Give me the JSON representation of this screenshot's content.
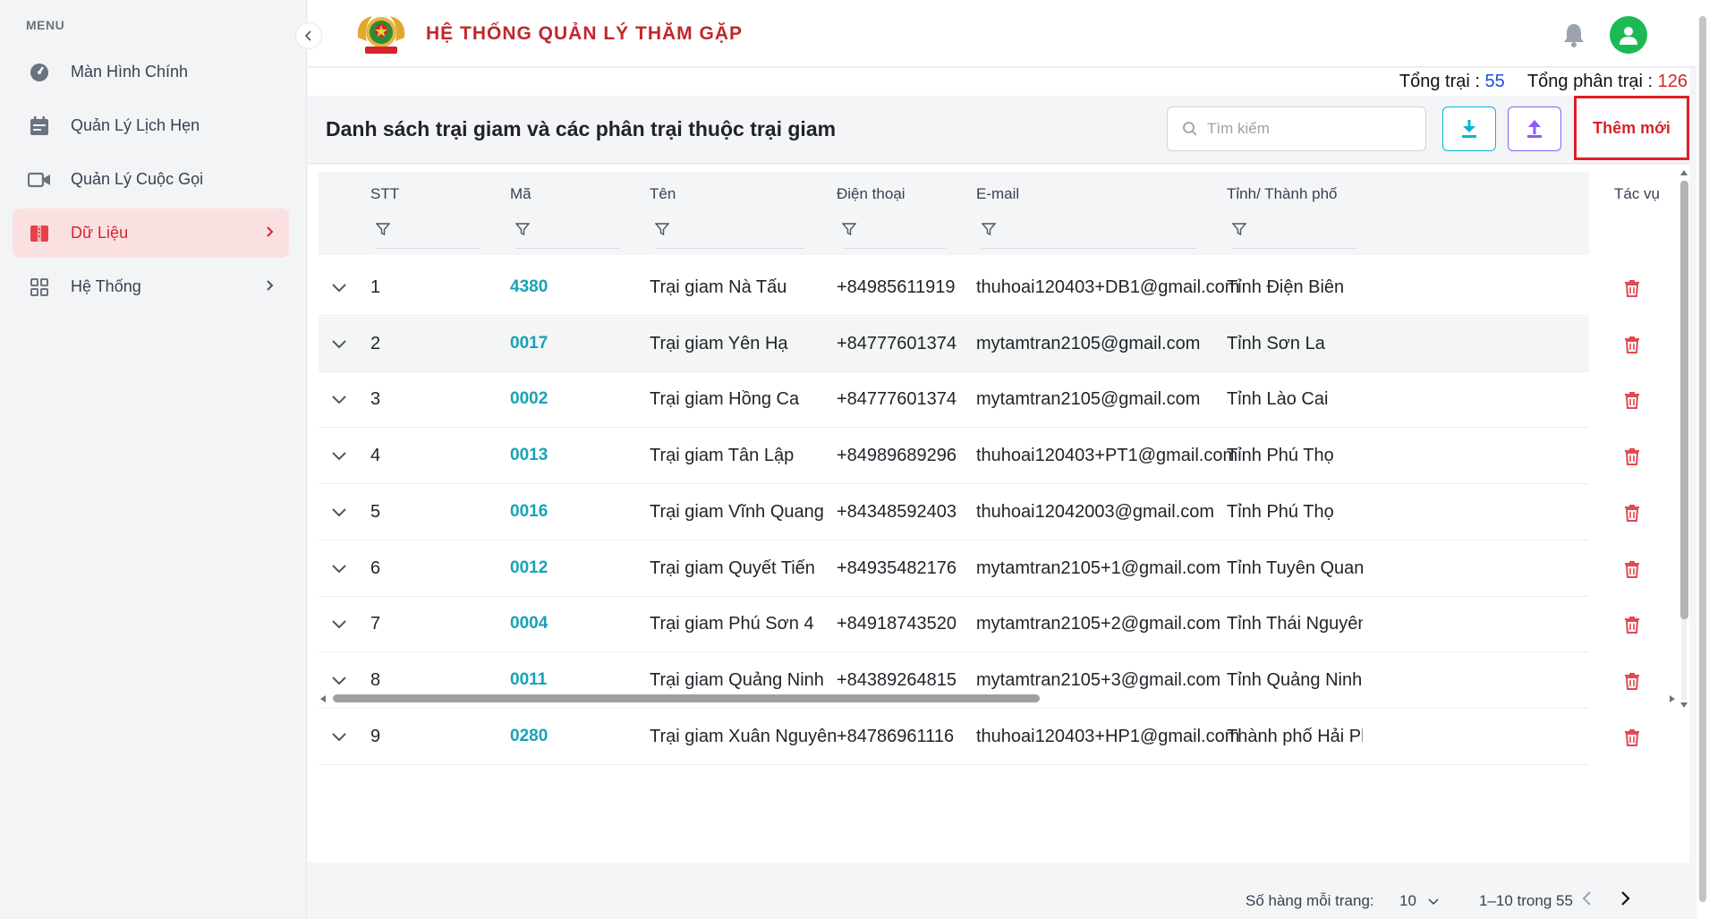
{
  "sidebar": {
    "menu_label": "MENU",
    "items": [
      {
        "label": "Màn Hình Chính",
        "icon": "dashboard-icon"
      },
      {
        "label": "Quản Lý Lịch Hẹn",
        "icon": "calendar-icon"
      },
      {
        "label": "Quản Lý Cuộc Gọi",
        "icon": "video-camera-icon"
      },
      {
        "label": "Dữ Liệu",
        "icon": "folder-icon",
        "active": true
      },
      {
        "label": "Hệ Thống",
        "icon": "grid-icon"
      }
    ]
  },
  "header": {
    "title": "HỆ THỐNG QUẢN LÝ THĂM GẶP"
  },
  "stats": {
    "camps_label": "Tổng trại :",
    "camps_value": "55",
    "subcamps_label": "Tổng phân trại :",
    "subcamps_value": "126"
  },
  "toolbar": {
    "title": "Danh sách trại giam và các phân trại thuộc trại giam",
    "search_placeholder": "Tìm kiếm",
    "add_label": "Thêm mới"
  },
  "table": {
    "columns": [
      "STT",
      "Mã",
      "Tên",
      "Điện thoại",
      "E-mail",
      "Tỉnh/ Thành phố"
    ],
    "action_column": "Tác vụ",
    "rows": [
      {
        "stt": "1",
        "code": "4380",
        "name": "Trại giam Nà Tấu",
        "phone": "+84985611919",
        "email": "thuhoai120403+DB1@gmail.com",
        "province": "Tỉnh Điện Biên"
      },
      {
        "stt": "2",
        "code": "0017",
        "name": "Trại giam Yên Hạ",
        "phone": "+84777601374",
        "email": "mytamtran2105@gmail.com",
        "province": "Tỉnh Sơn La"
      },
      {
        "stt": "3",
        "code": "0002",
        "name": "Trại giam Hồng Ca",
        "phone": "+84777601374",
        "email": "mytamtran2105@gmail.com",
        "province": "Tỉnh Lào Cai"
      },
      {
        "stt": "4",
        "code": "0013",
        "name": "Trại giam Tân Lập",
        "phone": "+84989689296",
        "email": "thuhoai120403+PT1@gmail.com",
        "province": "Tỉnh Phú Thọ"
      },
      {
        "stt": "5",
        "code": "0016",
        "name": "Trại giam Vĩnh Quang",
        "phone": "+84348592403",
        "email": "thuhoai12042003@gmail.com",
        "province": "Tỉnh Phú Thọ"
      },
      {
        "stt": "6",
        "code": "0012",
        "name": "Trại giam Quyết Tiến",
        "phone": "+84935482176",
        "email": "mytamtran2105+1@gmail.com",
        "province": "Tỉnh Tuyên Quang"
      },
      {
        "stt": "7",
        "code": "0004",
        "name": "Trại giam Phú Sơn 4",
        "phone": "+84918743520",
        "email": "mytamtran2105+2@gmail.com",
        "province": "Tỉnh Thái Nguyên"
      },
      {
        "stt": "8",
        "code": "0011",
        "name": "Trại giam Quảng Ninh",
        "phone": "+84389264815",
        "email": "mytamtran2105+3@gmail.com",
        "province": "Tỉnh Quảng Ninh"
      },
      {
        "stt": "9",
        "code": "0280",
        "name": "Trại giam Xuân Nguyên",
        "phone": "+84786961116",
        "email": "thuhoai120403+HP1@gmail.com",
        "province": "Thành phố Hải Phòn"
      }
    ]
  },
  "footer": {
    "rows_per_page_label": "Số hàng mỗi trang:",
    "rows_per_page_value": "10",
    "range": "1–10 trong 55"
  },
  "colors": {
    "accent_red": "#d6242d",
    "code_teal": "#17a2b8",
    "camps_blue": "#1d4ed8"
  }
}
